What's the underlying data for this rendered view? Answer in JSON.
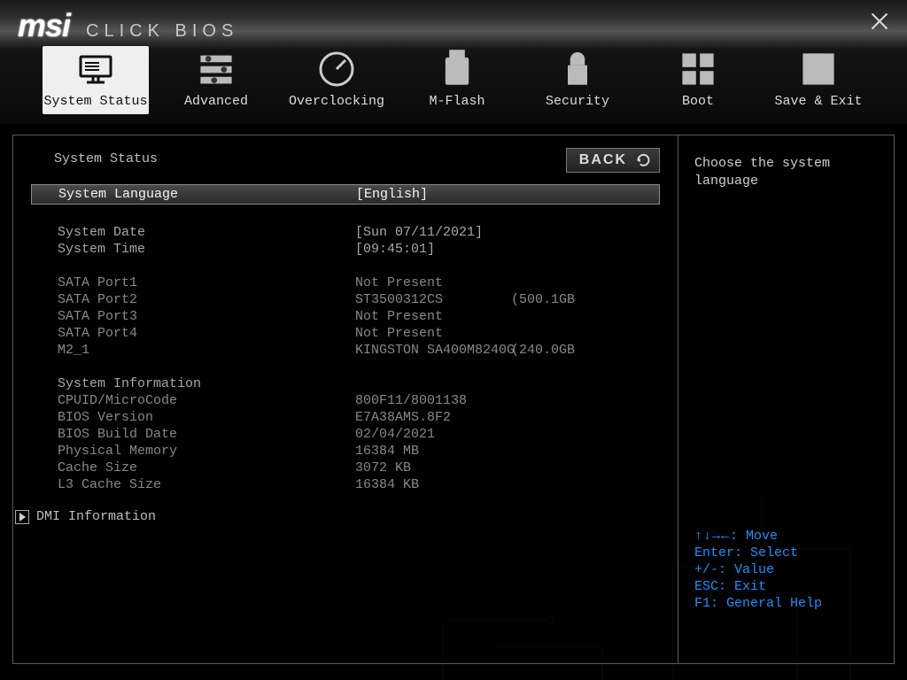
{
  "app_title": {
    "brand": "msi",
    "product": "CLICK BIOS"
  },
  "tabs": [
    {
      "id": "system-status",
      "label": "System Status",
      "active": true
    },
    {
      "id": "advanced",
      "label": "Advanced"
    },
    {
      "id": "overclocking",
      "label": "Overclocking"
    },
    {
      "id": "m-flash",
      "label": "M-Flash"
    },
    {
      "id": "security",
      "label": "Security"
    },
    {
      "id": "boot",
      "label": "Boot"
    },
    {
      "id": "save-exit",
      "label": "Save & Exit"
    }
  ],
  "back_label": "BACK",
  "page": {
    "title": "System Status",
    "language": {
      "label": "System Language",
      "value": "[English]"
    },
    "date": {
      "label": "System Date",
      "value": "[Sun 07/11/2021]"
    },
    "time": {
      "label": "System Time",
      "value": "[09:45:01]"
    },
    "storage": [
      {
        "label": "SATA Port1",
        "value": "Not Present",
        "extra": ""
      },
      {
        "label": "SATA Port2",
        "value": "ST3500312CS",
        "extra": "(500.1GB"
      },
      {
        "label": "SATA Port3",
        "value": "Not Present",
        "extra": ""
      },
      {
        "label": "SATA Port4",
        "value": "Not Present",
        "extra": ""
      },
      {
        "label": "M2_1",
        "value": "KINGSTON SA400M8240G",
        "extra": "(240.0GB"
      }
    ],
    "sysinfo_heading": "System Information",
    "sysinfo": [
      {
        "label": "CPUID/MicroCode",
        "value": "800F11/8001138"
      },
      {
        "label": "BIOS Version",
        "value": "E7A38AMS.8F2"
      },
      {
        "label": "BIOS Build Date",
        "value": "02/04/2021"
      },
      {
        "label": "Physical Memory",
        "value": "16384 MB"
      },
      {
        "label": "Cache Size",
        "value": "3072 KB"
      },
      {
        "label": "L3 Cache Size",
        "value": "16384 KB"
      }
    ],
    "submenu": {
      "label": "DMI Information"
    }
  },
  "help": {
    "text": "Choose the system language",
    "keys": {
      "arrows": "↑↓→←",
      "move": ": Move",
      "enter": "Enter: Select",
      "pm": "+/-: Value",
      "esc": "ESC: Exit",
      "f1": "F1: General Help"
    }
  }
}
